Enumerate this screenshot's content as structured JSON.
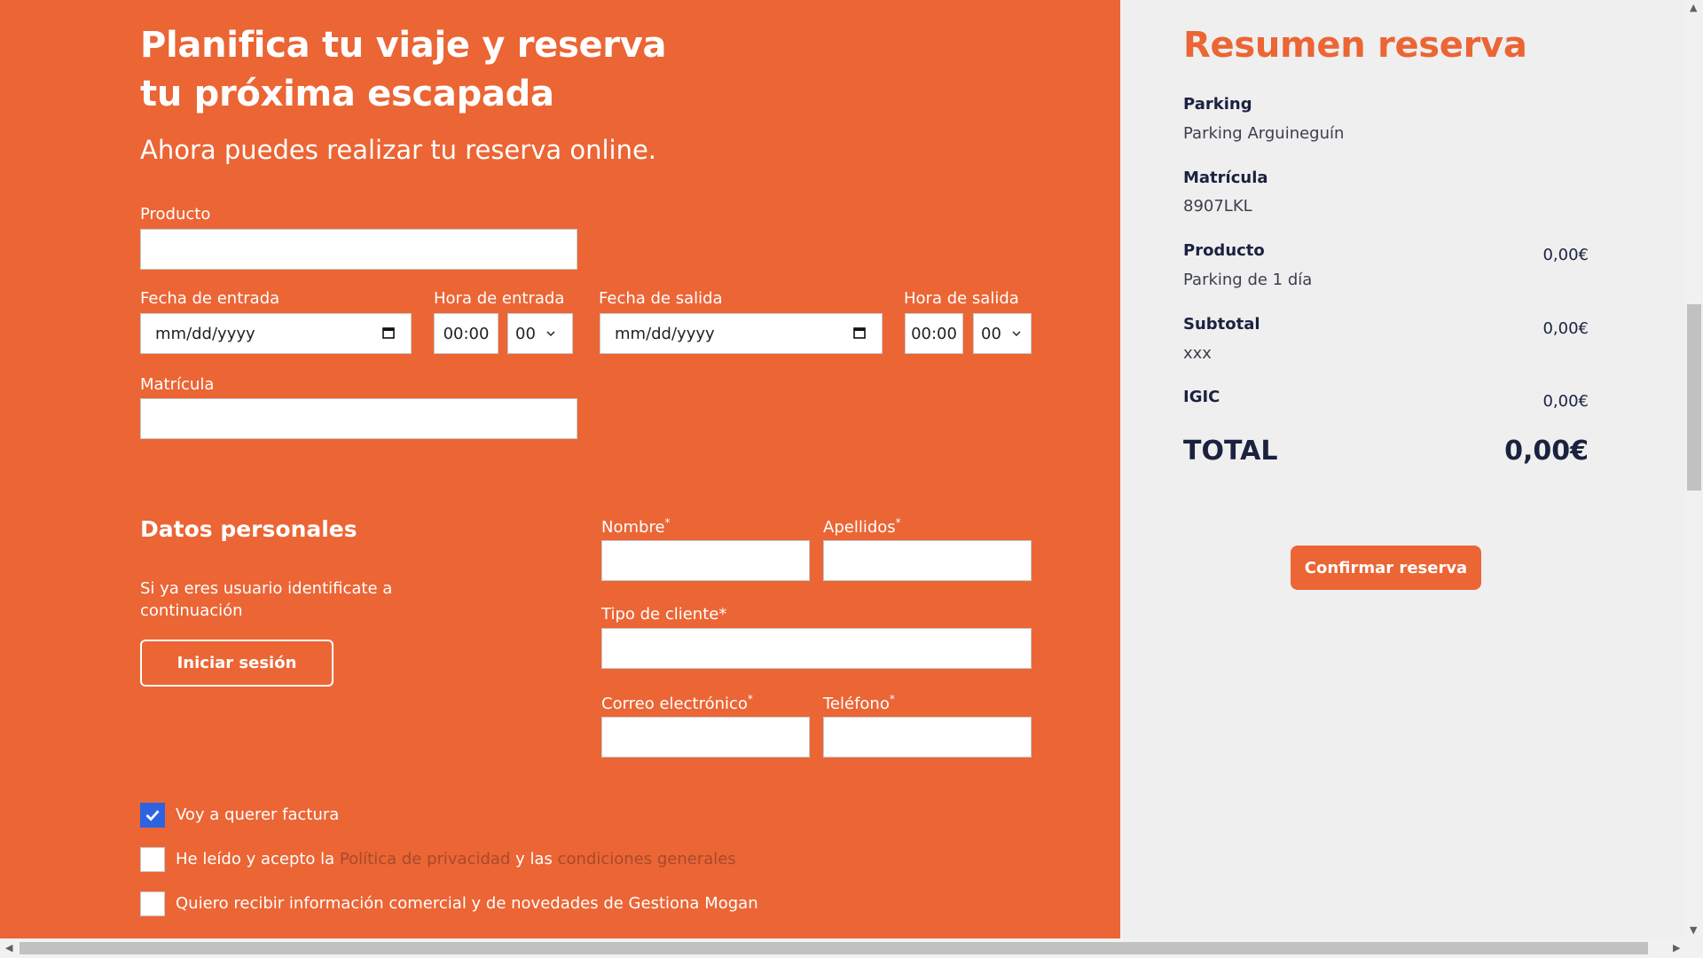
{
  "form": {
    "title": "Planifica tu viaje y reserva tu próxima escapada",
    "subtitle": "Ahora puedes realizar tu reserva online.",
    "producto_label": "Producto",
    "fecha_entrada_label": "Fecha de entrada",
    "fecha_entrada_placeholder": "mm/dd/yyyy",
    "hora_entrada_label": "Hora de entrada",
    "hora_entrada_value": "00:00",
    "hora_entrada_minutes": "00",
    "fecha_salida_label": "Fecha de salida",
    "fecha_salida_placeholder": "mm/dd/yyyy",
    "hora_salida_label": "Hora de salida",
    "hora_salida_value": "00:00",
    "hora_salida_minutes": "00",
    "matricula_label": "Matrícula"
  },
  "personal": {
    "title": "Datos personales",
    "hint": "Si ya eres usuario identificate a continuación",
    "login_button": "Iniciar sesión",
    "nombre_label": "Nombre",
    "apellidos_label": "Apellidos",
    "tipo_cliente_label": "Tipo de cliente*",
    "correo_label": "Correo electrónico",
    "telefono_label": "Teléfono",
    "required_mark": "*"
  },
  "checkboxes": {
    "factura": {
      "label": "Voy a querer factura",
      "checked": true
    },
    "terms": {
      "prefix": "He leído y acepto la ",
      "link1": "Política de privacidad",
      "middle": " y las ",
      "link2": "condiciones generales",
      "checked": false
    },
    "comercial": {
      "label": "Quiero recibir información comercial y de novedades de Gestiona Mogan",
      "checked": false
    }
  },
  "summary": {
    "title": "Resumen reserva",
    "parking_label": "Parking",
    "parking_value": "Parking Arguineguín",
    "matricula_label": "Matrícula",
    "matricula_value": "8907LKL",
    "producto_label": "Producto",
    "producto_value": "Parking de 1 día",
    "producto_amount": "0,00€",
    "subtotal_label": "Subtotal",
    "subtotal_value": "xxx",
    "subtotal_amount": "0,00€",
    "igic_label": "IGIC",
    "igic_amount": "0,00€",
    "total_label": "TOTAL",
    "total_amount": "0,00€",
    "confirm_button": "Confirmar reserva"
  },
  "colors": {
    "accent": "#eb6535",
    "summary_bg": "#efefef",
    "dark_text": "#1b2240",
    "checkbox_checked": "#2d63e0"
  }
}
